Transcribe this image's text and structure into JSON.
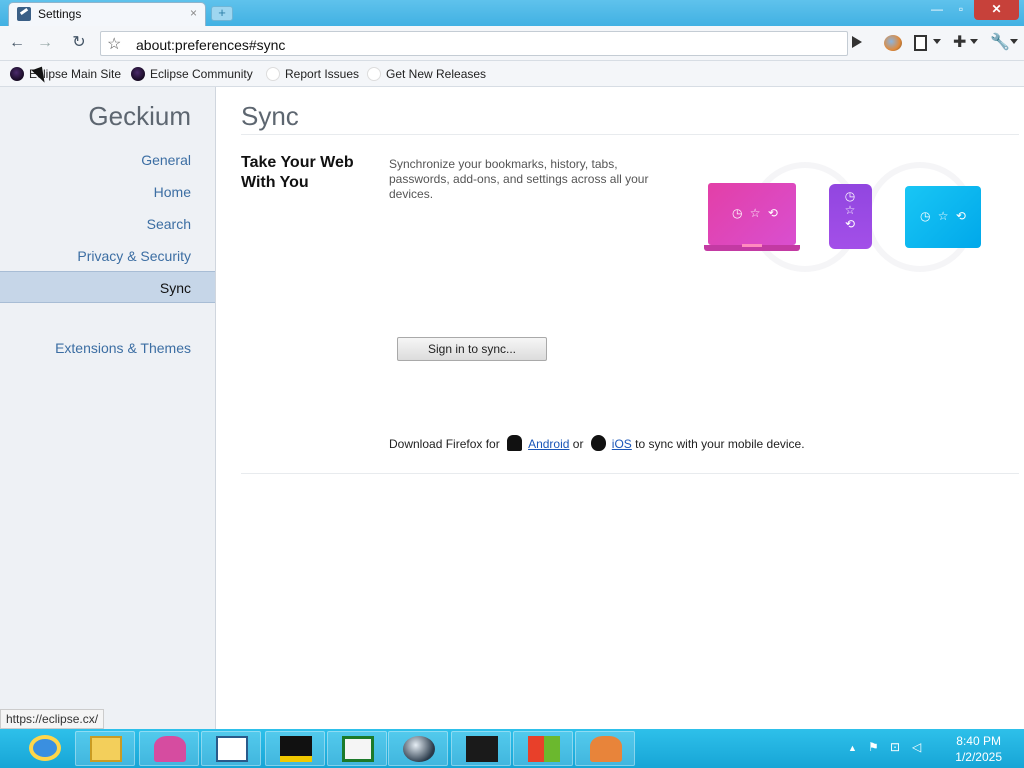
{
  "tab": {
    "title": "Settings",
    "close": "×",
    "new_tab": "+"
  },
  "window": {
    "minimize": "—",
    "maximize": "▫",
    "close": "✕"
  },
  "nav": {
    "back": "←",
    "forward": "→",
    "reload": "↻",
    "url": "about:preferences#sync",
    "star": "☆"
  },
  "bookmarks": [
    {
      "label": "Eclipse Main Site"
    },
    {
      "label": "Eclipse Community"
    },
    {
      "label": "Report Issues"
    },
    {
      "label": "Get New Releases"
    }
  ],
  "sidebar": {
    "brand": "Geckium",
    "items": [
      {
        "label": "General"
      },
      {
        "label": "Home"
      },
      {
        "label": "Search"
      },
      {
        "label": "Privacy & Security"
      },
      {
        "label": "Sync",
        "selected": true
      },
      {
        "label": "Extensions & Themes"
      }
    ]
  },
  "main": {
    "title": "Sync",
    "section_title": "Take Your Web With You",
    "section_desc": "Synchronize your bookmarks, history, tabs, passwords, add-ons, and settings across all your devices.",
    "signin_label": "Sign in to sync...",
    "download_prefix": "Download Firefox for",
    "android": "Android",
    "or": "or",
    "ios": "iOS",
    "download_suffix": "to sync with your mobile device.",
    "device_glyphs": {
      "laptop": "◷ ☆ ⟲",
      "phone": "◷ ☆ ⟲",
      "tablet": "◷ ☆ ⟲"
    },
    "colors": {
      "laptop": "#e33fa7",
      "phone": "#9146e0",
      "tablet": "#19c6f5",
      "link": "#1a56b8"
    }
  },
  "status_url": "https://eclipse.cx/",
  "taskbar": {
    "clock_time": "8:40 PM",
    "clock_date": "1/2/2025",
    "tray_arrow": "▲"
  }
}
